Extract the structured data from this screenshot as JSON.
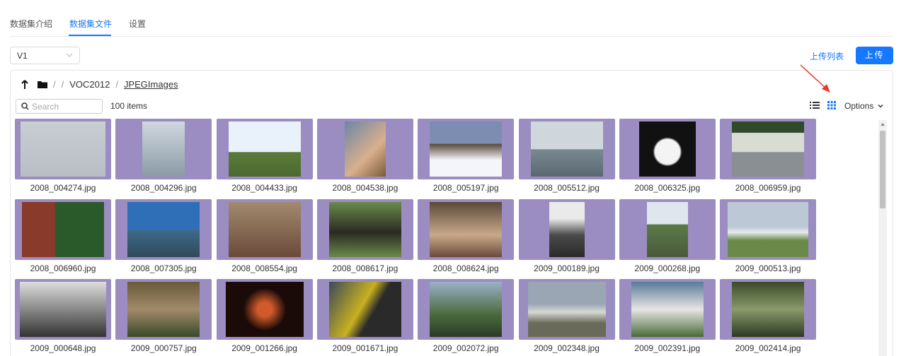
{
  "tabs": [
    {
      "label": "数据集介绍",
      "active": false
    },
    {
      "label": "数据集文件",
      "active": true
    },
    {
      "label": "设置",
      "active": false
    }
  ],
  "version_select": {
    "value": "V1"
  },
  "upload_list_label": "上传列表",
  "upload_button_label": "上传",
  "breadcrumb": {
    "sep1": "/",
    "sep2": "/",
    "folder": "VOC2012",
    "sep3": "/",
    "current": "JPEGImages"
  },
  "search": {
    "placeholder": "Search"
  },
  "item_count": "100 items",
  "options_label": "Options",
  "files": [
    "2008_004274.jpg",
    "2008_004296.jpg",
    "2008_004433.jpg",
    "2008_004538.jpg",
    "2008_005197.jpg",
    "2008_005512.jpg",
    "2008_006325.jpg",
    "2008_006959.jpg",
    "2008_006960.jpg",
    "2008_007305.jpg",
    "2008_008554.jpg",
    "2008_008617.jpg",
    "2008_008624.jpg",
    "2009_000189.jpg",
    "2009_000268.jpg",
    "2009_000513.jpg",
    "2009_000648.jpg",
    "2009_000757.jpg",
    "2009_001266.jpg",
    "2009_001671.jpg",
    "2009_002072.jpg",
    "2009_002348.jpg",
    "2009_002391.jpg",
    "2009_002414.jpg"
  ],
  "colors": {
    "accent": "#1677ff",
    "tile_bg": "#9b8dc1",
    "annotation": "#e8382e"
  }
}
